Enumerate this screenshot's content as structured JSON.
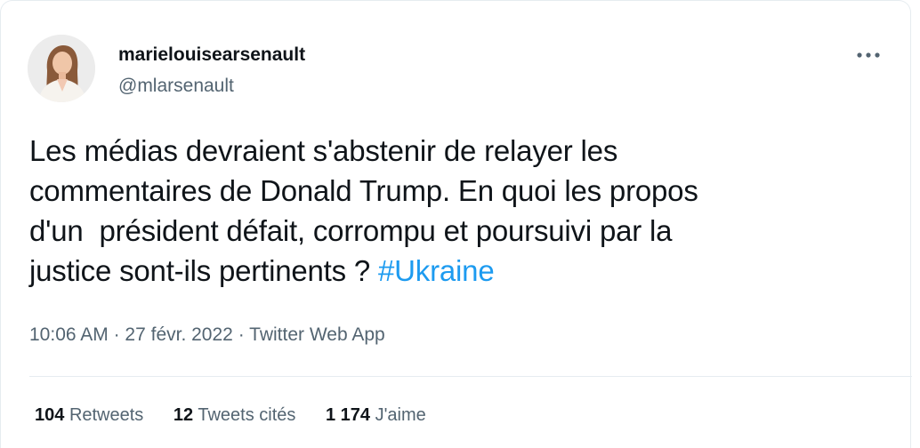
{
  "author": {
    "display_name": "marielouisearsenault",
    "handle": "@mlarsenault",
    "avatar_icon": "user-avatar"
  },
  "tweet": {
    "lines": [
      "Les médias devraient s'abstenir de relayer les",
      "commentaires de Donald Trump. En quoi les propos",
      "d'un  président défait, corrompu et poursuivi par la"
    ],
    "last_line_text": "justice sont-ils pertinents ? ",
    "hashtag": "#Ukraine"
  },
  "meta": {
    "time": "10:06 AM",
    "separator": "·",
    "date": "27 févr. 2022",
    "source": "Twitter Web App"
  },
  "stats": {
    "retweets": {
      "count": "104",
      "label": "Retweets"
    },
    "quotes": {
      "count": "12",
      "label": "Tweets cités"
    },
    "likes": {
      "count": "1 174",
      "label": "J'aime"
    }
  },
  "colors": {
    "text": "#0f1419",
    "secondary": "#536471",
    "link": "#1d9bf0",
    "border": "#e6ecf0"
  },
  "icons": {
    "more": "more-horizontal-icon"
  }
}
